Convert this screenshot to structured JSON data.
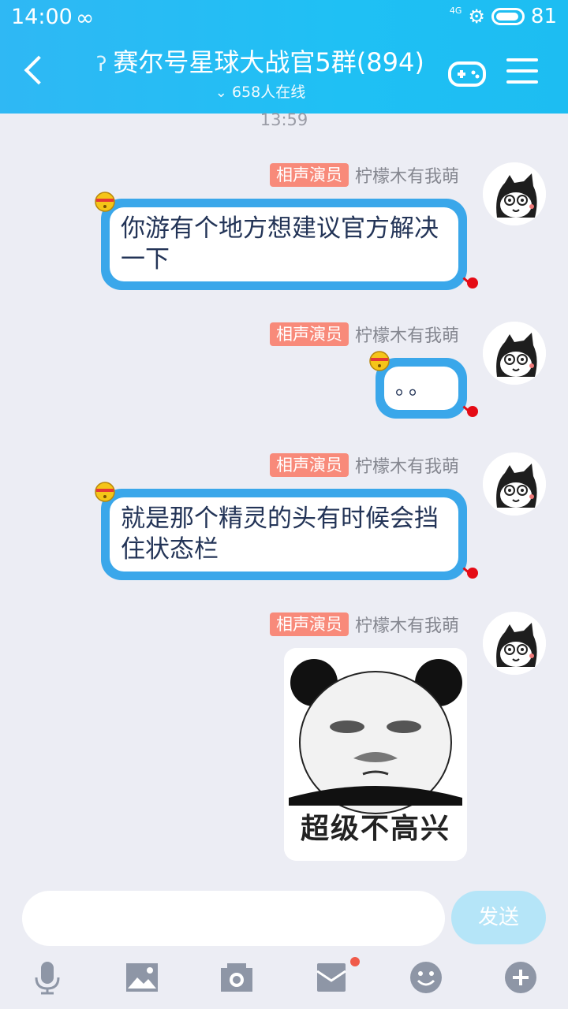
{
  "status_bar": {
    "time": "14:00",
    "net": "4G",
    "battery": "81"
  },
  "header": {
    "title": "赛尔号星球大战官5群(894)",
    "online": "658人在线"
  },
  "chat": {
    "timestamp": "13:59",
    "messages": [
      {
        "badge": "相声演员",
        "nick": "柠檬木有我萌",
        "text": "你游有个地方想建议官方解决一下"
      },
      {
        "badge": "相声演员",
        "nick": "柠檬木有我萌",
        "text": "。。"
      },
      {
        "badge": "相声演员",
        "nick": "柠檬木有我萌",
        "text": "就是那个精灵的头有时候会挡住状态栏"
      },
      {
        "badge": "相声演员",
        "nick": "柠檬木有我萌",
        "sticker_text": "超级不高兴"
      }
    ]
  },
  "input": {
    "send_label": "发送"
  },
  "toolbar": {
    "icons": [
      "microphone-icon",
      "image-icon",
      "camera-icon",
      "red-packet-icon",
      "emoji-icon",
      "plus-icon"
    ]
  },
  "colors": {
    "header": "#1fc0f4",
    "bubble_border": "#3aa7ea",
    "badge": "#f88a7a",
    "background": "#ecedf4"
  }
}
